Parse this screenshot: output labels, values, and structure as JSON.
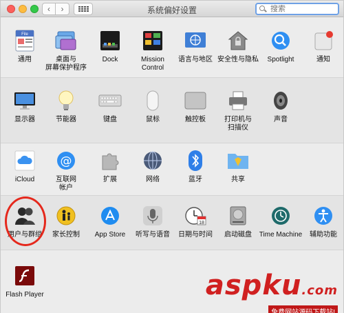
{
  "window": {
    "title": "系统偏好设置"
  },
  "search": {
    "placeholder": "搜索"
  },
  "rows": [
    [
      "通用",
      "桌面与\n屏幕保护程序",
      "Dock",
      "Mission\nControl",
      "语言与地区",
      "安全性与隐私",
      "Spotlight",
      "通知"
    ],
    [
      "显示器",
      "节能器",
      "键盘",
      "鼠标",
      "触控板",
      "打印机与\n扫描仪",
      "声音"
    ],
    [
      "iCloud",
      "互联网\n帐户",
      "扩展",
      "网络",
      "蓝牙",
      "共享"
    ],
    [
      "用户与群组",
      "家长控制",
      "App Store",
      "听写与语音",
      "日期与时间",
      "启动磁盘",
      "Time Machine",
      "辅助功能"
    ],
    [
      "Flash Player"
    ]
  ],
  "icons": {
    "general": "file-icon",
    "desktop": "desktop-icon",
    "dock": "dock-icon",
    "mission": "mission-control-icon",
    "language": "un-flag-icon",
    "security": "house-lock-icon",
    "spotlight": "magnifier-icon",
    "notifications": "notification-icon"
  },
  "dock_icon_text": "File",
  "date_icon_text": "18",
  "watermark": {
    "brand": "aspku",
    "tld": ".com",
    "tagline": "免费网站源码下载站!"
  },
  "colors": {
    "accent": "#2f8ff2",
    "highlight_circle": "#e5281c"
  }
}
